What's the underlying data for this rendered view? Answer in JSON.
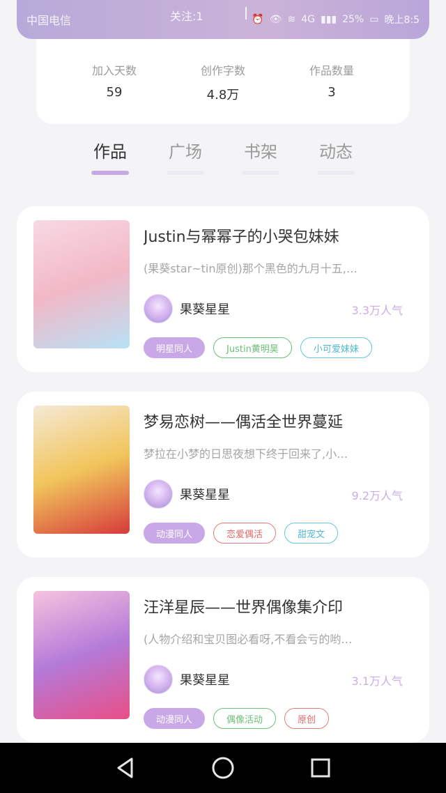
{
  "status_bar": {
    "carrier": "中国电信",
    "follow": "关注:1",
    "battery": "25%",
    "network": "4G",
    "time": "晚上8:5"
  },
  "stats": [
    {
      "label": "加入天数",
      "value": "59"
    },
    {
      "label": "创作字数",
      "value": "4.8万"
    },
    {
      "label": "作品数量",
      "value": "3"
    }
  ],
  "tabs": [
    {
      "label": "作品",
      "active": true
    },
    {
      "label": "广场",
      "active": false
    },
    {
      "label": "书架",
      "active": false
    },
    {
      "label": "动态",
      "active": false
    }
  ],
  "works": [
    {
      "title": "Justin与幂幂子的小哭包妹妹",
      "desc": "(果葵star~tin原创)那个黑色的九月十五,…",
      "author": "果葵星星",
      "popularity": "3.3万人气",
      "tags": [
        {
          "label": "明星同人",
          "style": "filled"
        },
        {
          "label": "Justin黄明昊",
          "style": "green"
        },
        {
          "label": "小可爱妹妹",
          "style": "blue"
        }
      ],
      "cover_colors": [
        "#f7d9e4",
        "#f2b8c6",
        "#b8e1f5"
      ]
    },
    {
      "title": "梦易恋树——偶活全世界蔓延",
      "desc": "梦拉在小梦的日思夜想下终于回来了,小…",
      "author": "果葵星星",
      "popularity": "9.2万人气",
      "tags": [
        {
          "label": "动漫同人",
          "style": "filled"
        },
        {
          "label": "恋爱偶活",
          "style": "red"
        },
        {
          "label": "甜宠文",
          "style": "blue"
        }
      ],
      "cover_colors": [
        "#f5e9d6",
        "#f1c55b",
        "#d63b3b"
      ]
    },
    {
      "title": "汪洋星辰——世界偶像集介印",
      "desc": "(人物介绍和宝贝图必看呀,不看会亏的哟…",
      "author": "果葵星星",
      "popularity": "3.1万人气",
      "tags": [
        {
          "label": "动漫同人",
          "style": "filled"
        },
        {
          "label": "偶像活动",
          "style": "green"
        },
        {
          "label": "原创",
          "style": "red"
        }
      ],
      "cover_colors": [
        "#f6c3dd",
        "#b47ad8",
        "#e94f86"
      ]
    }
  ]
}
